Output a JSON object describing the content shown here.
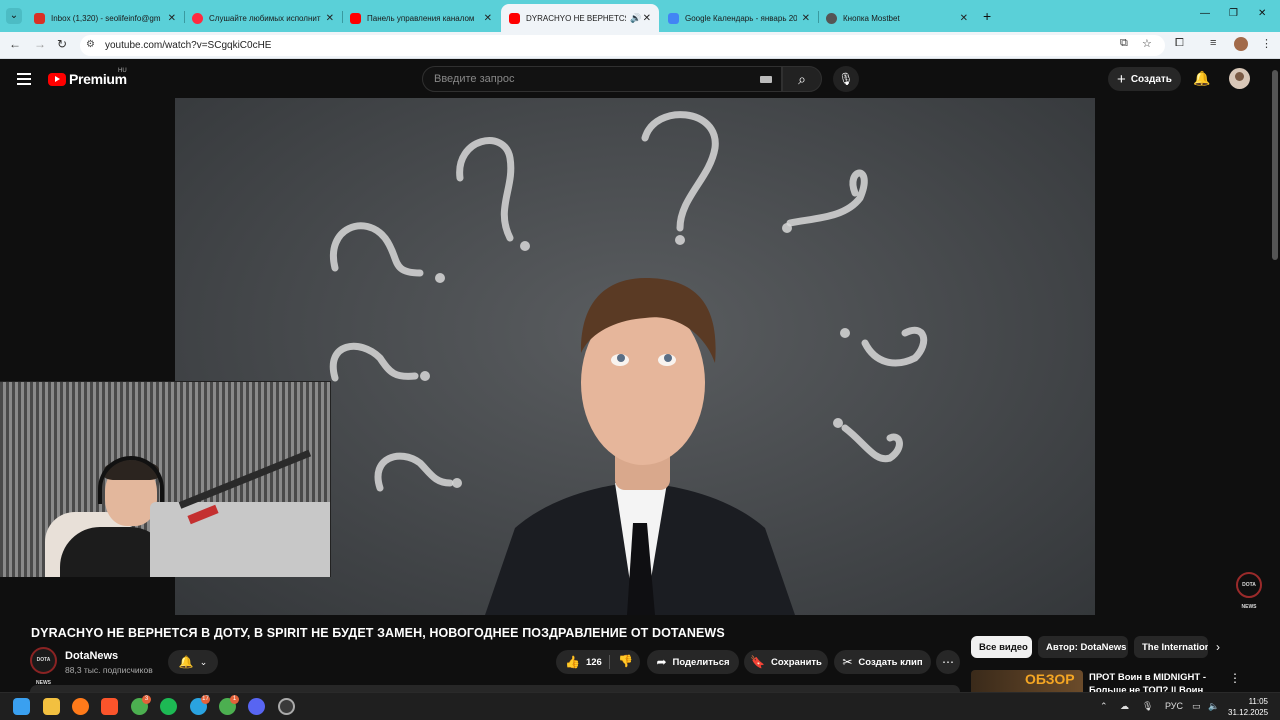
{
  "browser": {
    "tabs": [
      {
        "title": "Inbox (1,320) - seolifeinfo@gm",
        "icon": "gmail-icon",
        "color": "#d93025",
        "active": false
      },
      {
        "title": "Слушайте любимых исполнит",
        "icon": "music-icon",
        "color": "#ff2a40",
        "active": false
      },
      {
        "title": "Панель управления каналом",
        "icon": "youtube-studio-icon",
        "color": "#ff0000",
        "active": false
      },
      {
        "title": "DYRACHYO НЕ ВЕРНЕТСЯ В",
        "icon": "youtube-icon",
        "color": "#ff0000",
        "active": true
      },
      {
        "title": "Google Календарь - январь 20",
        "icon": "calendar-icon",
        "color": "#4285f4",
        "active": false
      },
      {
        "title": "Кнопка Mostbet",
        "icon": "globe-icon",
        "color": "#555555",
        "active": false
      }
    ],
    "close_glyph": "✕",
    "new_tab_glyph": "+",
    "url": "youtube.com/watch?v=SCgqkiC0cHE"
  },
  "youtube": {
    "logo_text": "Premium",
    "country_code": "HU",
    "search_placeholder": "Введите запрос",
    "create_label": "Создать",
    "accent": "#ff0000"
  },
  "webcam": {},
  "video": {
    "title": "DYRACHYO НЕ ВЕРНЕТСЯ В ДОТУ, В SPIRIT НЕ БУДЕТ ЗАМЕН, НОВОГОДНЕЕ ПОЗДРАВЛЕНИЕ ОТ DOTANEWS",
    "watermark_text": "DOTA NEWS"
  },
  "channel": {
    "name": "DotaNews",
    "subscribers": "88,3 тыс. подписчиков",
    "avatar_text": "DOTA NEWS"
  },
  "actions": {
    "like_count": "126",
    "share_label": "Поделиться",
    "save_label": "Сохранить",
    "clip_label": "Создать клип"
  },
  "chips": [
    {
      "label": "Все видео",
      "selected": true
    },
    {
      "label": "Автор: DotaNews",
      "selected": false
    },
    {
      "label": "The Internation",
      "selected": false
    }
  ],
  "recommendation": {
    "thumb_text": "ОБЗОР",
    "title": "ПРОТ Воин в MIDNIGHT - Больше не ТОП? || Воин"
  },
  "taskbar": {
    "badges": {
      "b1": "3",
      "b2": "17",
      "b3": "1"
    },
    "language": "РУС",
    "time": "11:05",
    "date": "31.12.2025"
  }
}
